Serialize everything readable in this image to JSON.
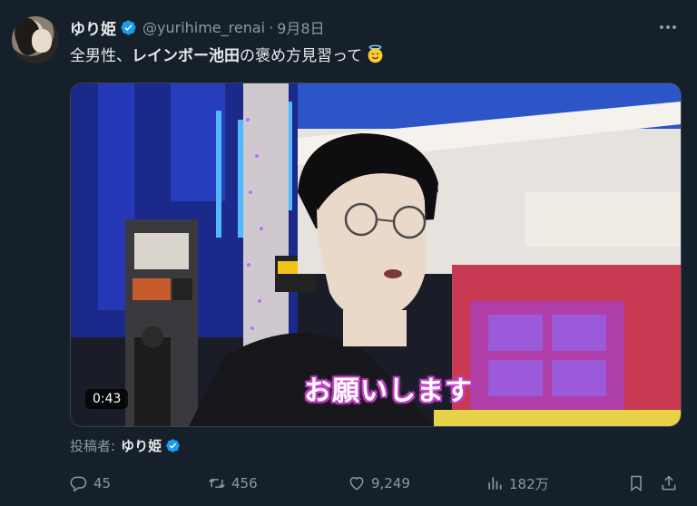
{
  "tweet": {
    "author_name": "ゆり姫",
    "handle": "@yurihime_renai",
    "separator": "·",
    "date": "9月8日",
    "text_before": "全男性、",
    "text_bold": "レインボー池田",
    "text_after": "の褒め方見習って",
    "emoji": "smiling-face-with-halo"
  },
  "media": {
    "subtitle": "お願いします",
    "duration": "0:43"
  },
  "poster": {
    "label": "投稿者:",
    "name": "ゆり姫"
  },
  "actions": {
    "replies": "45",
    "retweets": "456",
    "likes": "9,249",
    "views": "182万"
  },
  "colors": {
    "background": "#15202b",
    "verified": "#1d9bf0",
    "secondary_text": "#8b98a5"
  }
}
